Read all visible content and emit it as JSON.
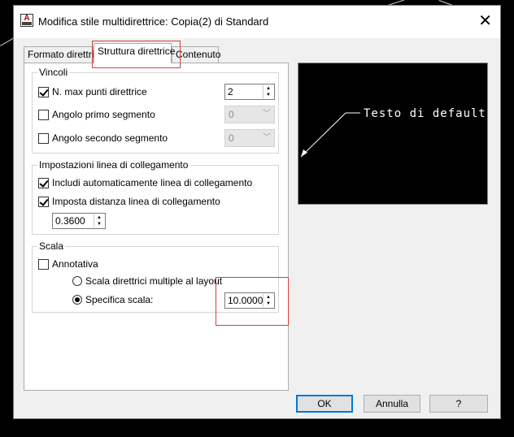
{
  "window": {
    "title": "Modifica stile multidirettrice: Copia(2) di Standard",
    "app_icon": "A",
    "close_label": "✕"
  },
  "tabs": [
    {
      "label": "Formato direttrice",
      "active": false
    },
    {
      "label": "Struttura direttrice",
      "active": true
    },
    {
      "label": "Contenuto",
      "active": false
    }
  ],
  "constraints": {
    "group_label": "Vincoli",
    "max_points": {
      "label": "N. max punti direttrice",
      "checked": true,
      "value": "2"
    },
    "first_segment_angle": {
      "label": "Angolo primo segmento",
      "checked": false,
      "value": "0"
    },
    "second_segment_angle": {
      "label": "Angolo secondo segmento",
      "checked": false,
      "value": "0"
    }
  },
  "landing": {
    "group_label": "Impostazioni linea di collegamento",
    "auto_include": {
      "label": "Includi automaticamente linea di collegamento",
      "checked": true
    },
    "set_distance": {
      "label": "Imposta distanza linea di collegamento",
      "checked": true,
      "value": "0.3600"
    }
  },
  "scale": {
    "group_label": "Scala",
    "annotative": {
      "label": "Annotativa",
      "checked": false
    },
    "scale_to_layout": {
      "label": "Scala direttrici multiple al layout",
      "selected": false
    },
    "specify_scale": {
      "label": "Specifica scala:",
      "selected": true,
      "value": "10.0000"
    }
  },
  "preview": {
    "text": "Testo di default"
  },
  "buttons": {
    "ok": "OK",
    "cancel": "Annulla",
    "help": "?"
  },
  "colors": {
    "highlight": "#d04040",
    "preview_bg": "#000000",
    "default_button_border": "#0078d7"
  }
}
